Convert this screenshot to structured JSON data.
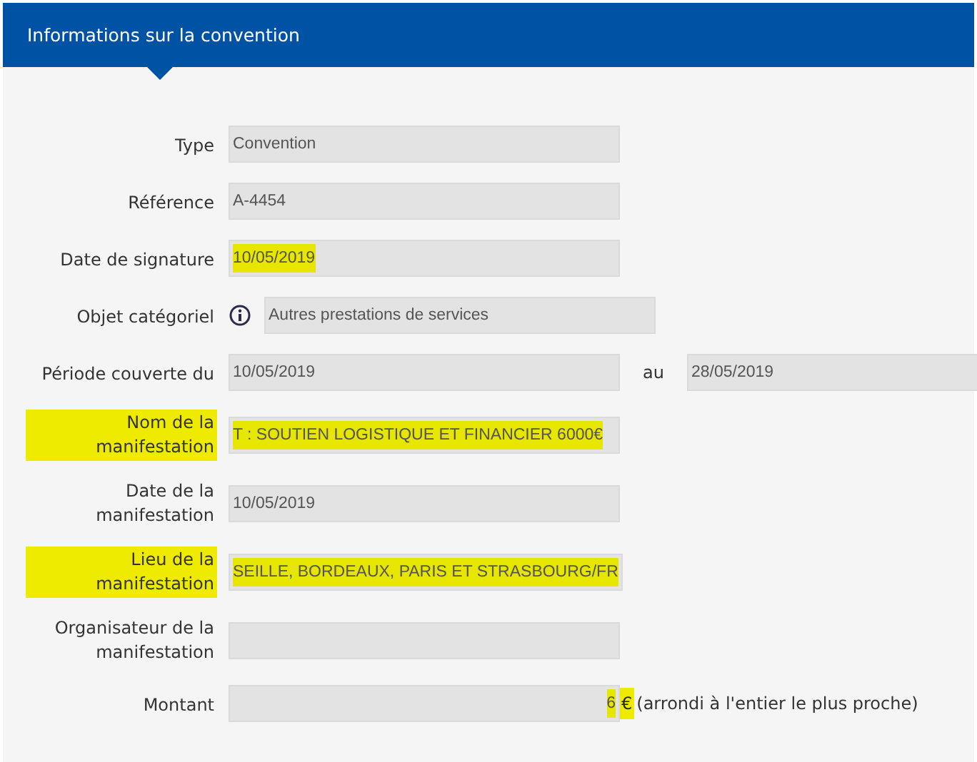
{
  "header": {
    "title": "Informations sur la convention"
  },
  "fields": [
    {
      "kind": "text",
      "label": "Type",
      "value": "Convention",
      "label_highlighted": false,
      "value_highlighted": false
    },
    {
      "kind": "text",
      "label": "Référence",
      "value": "A-4454",
      "label_highlighted": false,
      "value_highlighted": false
    },
    {
      "kind": "text",
      "label": "Date de signature",
      "value": "10/05/2019",
      "label_highlighted": false,
      "value_highlighted": true
    },
    {
      "kind": "info",
      "label": "Objet catégoriel",
      "value": "Autres prestations de services",
      "label_highlighted": false,
      "value_highlighted": false
    },
    {
      "kind": "range",
      "label": "Période couverte du",
      "value": "10/05/2019",
      "separator": "au",
      "value_to": "28/05/2019",
      "label_highlighted": false,
      "value_highlighted": false
    },
    {
      "kind": "text",
      "label": "Nom de la manifestation",
      "value": "T : SOUTIEN LOGISTIQUE ET FINANCIER 6000€",
      "label_highlighted": true,
      "value_highlighted": true
    },
    {
      "kind": "text",
      "label": "Date de la manifestation",
      "value": "10/05/2019",
      "label_highlighted": false,
      "value_highlighted": false
    },
    {
      "kind": "text",
      "label": "Lieu de la manifestation",
      "value": "SEILLE, BORDEAUX, PARIS ET STRASBOURG/FR",
      "label_highlighted": true,
      "value_highlighted": true
    },
    {
      "kind": "text",
      "label": "Organisateur de la manifestation",
      "label_highlighted": false
    },
    {
      "kind": "amount",
      "label": "Montant",
      "value": "6",
      "unit": "€",
      "note": "(arrondi à l'entier le plus proche)",
      "label_highlighted": false,
      "value_highlighted": true
    }
  ]
}
